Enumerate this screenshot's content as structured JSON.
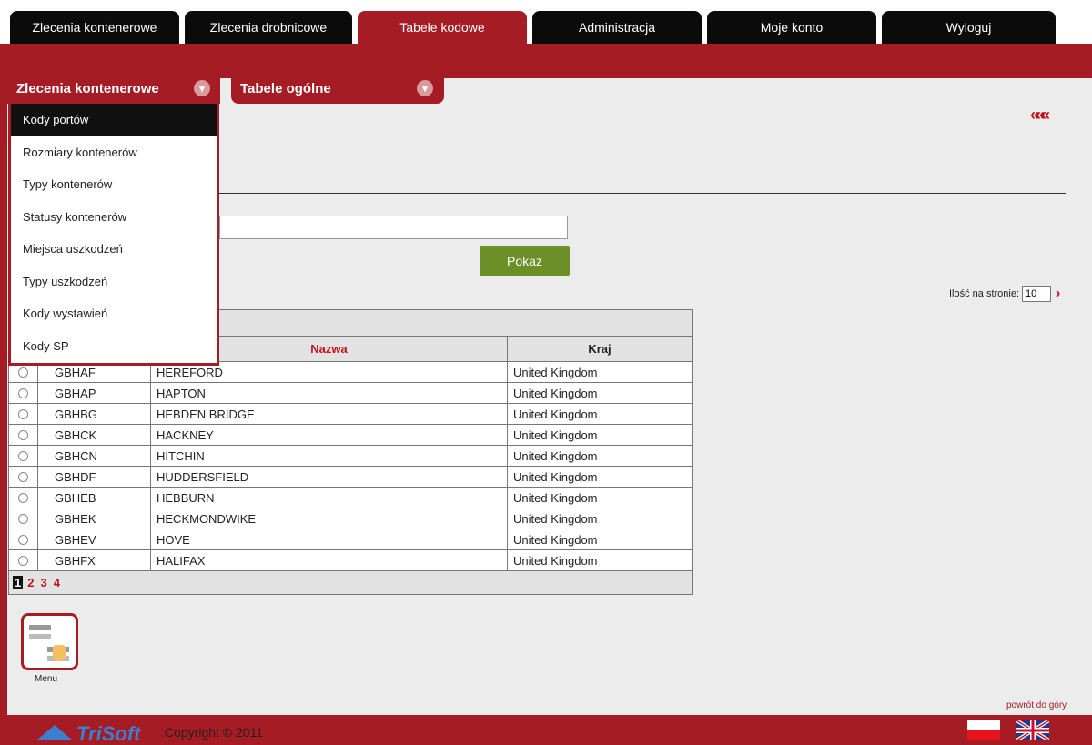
{
  "topnav": {
    "tabs": [
      "Zlecenia kontenerowe",
      "Zlecenia drobnicowe",
      "Tabele kodowe",
      "Administracja",
      "Moje konto",
      "Wyloguj"
    ],
    "active": "Tabele kodowe"
  },
  "subnav": {
    "tab1": "Zlecenia kontenerowe",
    "tab2": "Tabele ogólne"
  },
  "dropdown": {
    "items": [
      "Kody portów",
      "Rozmiary kontenerów",
      "Typy kontenerów",
      "Statusy kontenerów",
      "Miejsca uszkodzeń",
      "Typy uszkodzeń",
      "Kody wystawień",
      "Kody SP"
    ],
    "active": "Kody portów"
  },
  "back_arrow": "«««",
  "search": {
    "value": "",
    "button": "Pokaż"
  },
  "per_page": {
    "label": "Ilość na stronie:",
    "value": "10",
    "next": "›"
  },
  "table": {
    "columns": [
      "Nazwa",
      "Kraj"
    ],
    "rows": [
      {
        "code": "GBHAF",
        "name": "HEREFORD",
        "country": "United Kingdom"
      },
      {
        "code": "GBHAP",
        "name": "HAPTON",
        "country": "United Kingdom"
      },
      {
        "code": "GBHBG",
        "name": "HEBDEN BRIDGE",
        "country": "United Kingdom"
      },
      {
        "code": "GBHCK",
        "name": "HACKNEY",
        "country": "United Kingdom"
      },
      {
        "code": "GBHCN",
        "name": "HITCHIN",
        "country": "United Kingdom"
      },
      {
        "code": "GBHDF",
        "name": "HUDDERSFIELD",
        "country": "United Kingdom"
      },
      {
        "code": "GBHEB",
        "name": "HEBBURN",
        "country": "United Kingdom"
      },
      {
        "code": "GBHEK",
        "name": "HECKMONDWIKE",
        "country": "United Kingdom"
      },
      {
        "code": "GBHEV",
        "name": "HOVE",
        "country": "United Kingdom"
      },
      {
        "code": "GBHFX",
        "name": "HALIFAX",
        "country": "United Kingdom"
      }
    ],
    "pages": [
      "1",
      "2",
      "3",
      "4"
    ],
    "current_page": "1"
  },
  "menu_icon": {
    "label": "Menu",
    "icon": "menu-cards-icon"
  },
  "back_to_top": "powrót do góry",
  "footer": {
    "logo": "TriSoft",
    "copyright": "Copyright © 2011",
    "flags": [
      "flag-pl-icon",
      "flag-uk-icon"
    ]
  },
  "colors": {
    "brand_red": "#a51c24",
    "accent_red": "#c0141c",
    "button_green": "#6c8f27",
    "dark": "#0b0b0b"
  }
}
